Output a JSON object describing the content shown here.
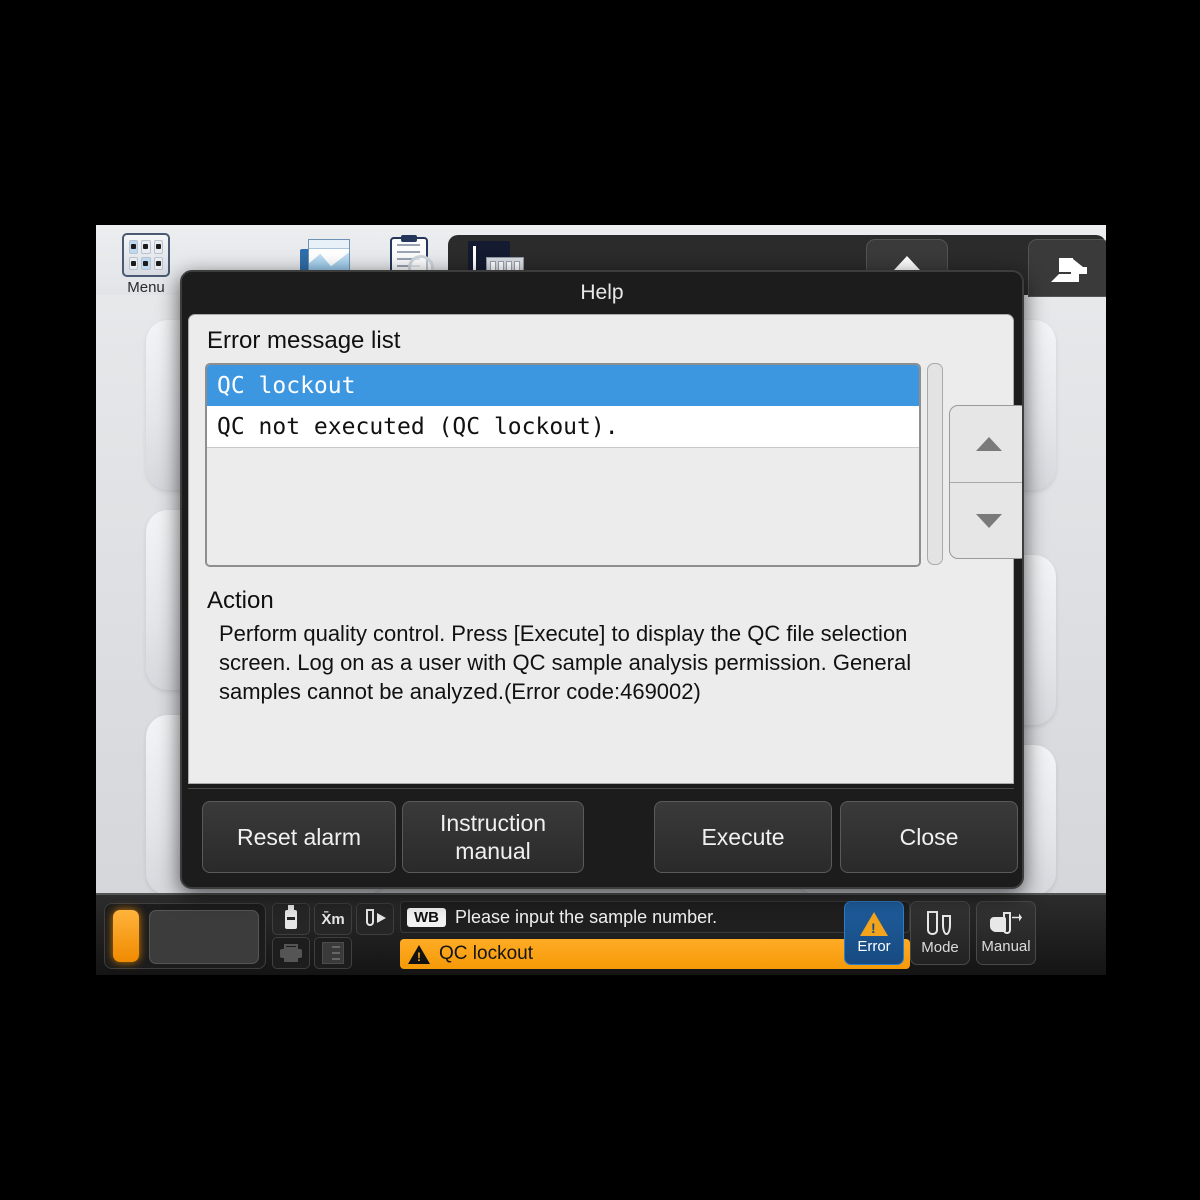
{
  "toolbar": {
    "menu_label": "Menu",
    "icons": [
      {
        "name": "menu-grid-icon",
        "label": "Menu"
      },
      {
        "name": "sample-explorer-icon",
        "label": ""
      },
      {
        "name": "worklist-icon",
        "label": ""
      },
      {
        "name": "qc-chart-icon",
        "label": ""
      }
    ],
    "right_buttons": [
      {
        "name": "up-arrow-icon",
        "label": ""
      },
      {
        "name": "logoff-icon",
        "label": ""
      }
    ]
  },
  "dialog": {
    "title": "Help",
    "error_list_label": "Error message list",
    "error_list": [
      {
        "text": "QC lockout",
        "selected": true
      },
      {
        "text": "QC not executed (QC lockout).",
        "selected": false
      }
    ],
    "scroll_up_label": "▲",
    "scroll_down_label": "▼",
    "action_label": "Action",
    "action_text": "Perform quality control. Press [Execute] to display the QC file selection screen. Log on as a user with QC sample analysis permission. General samples cannot be analyzed.(Error code:469002)",
    "buttons": {
      "reset_alarm": "Reset alarm",
      "instruction_manual": "Instruction manual",
      "execute": "Execute",
      "close": "Close"
    }
  },
  "statusbar": {
    "wb_badge": "WB",
    "message": "Please input the sample number.",
    "alert": "QC lockout",
    "buttons": [
      {
        "name": "error-button",
        "label": "Error",
        "active": true
      },
      {
        "name": "mode-button",
        "label": "Mode",
        "active": false
      },
      {
        "name": "manual-button",
        "label": "Manual",
        "active": false
      }
    ],
    "small_icons": [
      {
        "name": "reagent-bottle-icon"
      },
      {
        "name": "xbar-m-icon",
        "label": "X̄m"
      },
      {
        "name": "tube-feed-icon"
      },
      {
        "name": "printer-icon"
      },
      {
        "name": "data-list-icon"
      }
    ]
  },
  "colors": {
    "selection_blue": "#3d97e0",
    "alert_orange": "#f59a08",
    "error_button_blue": "#1f5e9e",
    "dialog_dark": "#1c1c1c"
  }
}
